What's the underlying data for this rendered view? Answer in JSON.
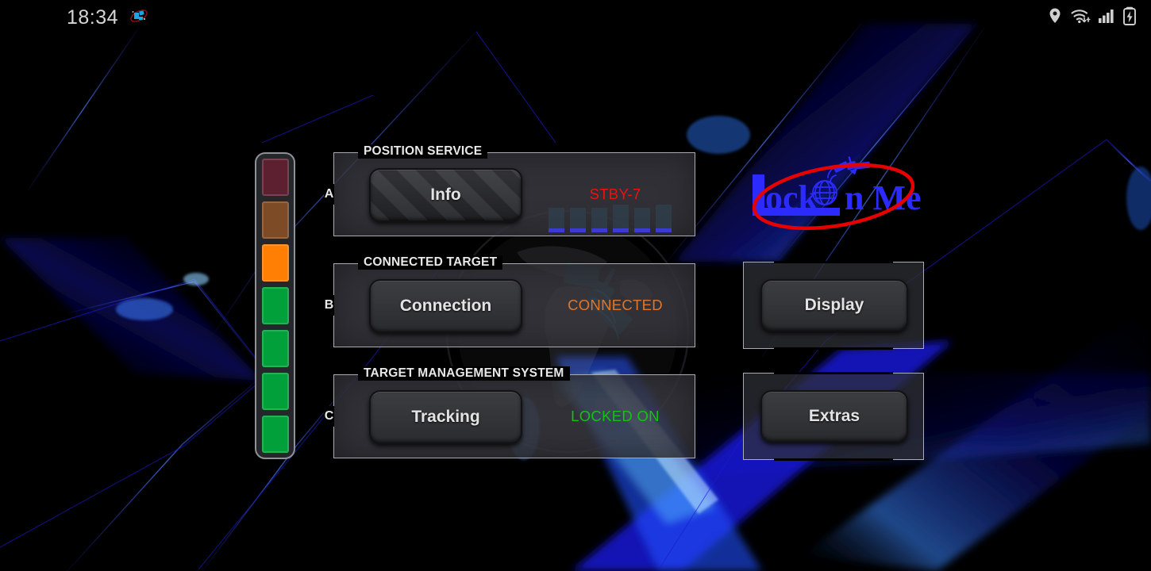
{
  "status_bar": {
    "time": "18:34",
    "notification_icons": [
      {
        "name": "satellite-app-icon"
      }
    ],
    "system_icons": [
      {
        "name": "location-pin-icon"
      },
      {
        "name": "wifi-icon"
      },
      {
        "name": "cellular-signal-icon"
      },
      {
        "name": "battery-charging-icon"
      }
    ]
  },
  "signal_meter": {
    "name": "signal-strength-meter",
    "segments": [
      {
        "index": 1,
        "color": "#5c2030"
      },
      {
        "index": 2,
        "color": "#7d4b26"
      },
      {
        "index": 3,
        "color": "#ff7f05"
      },
      {
        "index": 4,
        "color": "#02a03a"
      },
      {
        "index": 5,
        "color": "#02a03a"
      },
      {
        "index": 6,
        "color": "#02a03a"
      },
      {
        "index": 7,
        "color": "#02a03a"
      }
    ]
  },
  "panels": [
    {
      "key": "a",
      "side_label": "A",
      "legend": "POSITION SERVICE",
      "button_label": "Info",
      "button_disabled": true,
      "status_label": "STBY-7",
      "status_color": "#ee1111",
      "satellite_bars": [
        26,
        26,
        26,
        30,
        26,
        30
      ]
    },
    {
      "key": "b",
      "side_label": "B",
      "legend": "CONNECTED TARGET",
      "button_label": "Connection",
      "button_disabled": false,
      "status_label": "CONNECTED",
      "status_color": "#e0762a"
    },
    {
      "key": "c",
      "side_label": "C",
      "legend": "TARGET MANAGEMENT SYSTEM",
      "button_label": "Tracking",
      "button_disabled": false,
      "status_label": "LOCKED ON",
      "status_color": "#13c313"
    }
  ],
  "right_panels": [
    {
      "key": "display",
      "button_label": "Display"
    },
    {
      "key": "extras",
      "button_label": "Extras"
    }
  ],
  "logo": {
    "text_part1": "L",
    "text_part2": "ock ",
    "text_part3": "n Me",
    "text_color": "#2b2bff",
    "orbit_color": "#e60000",
    "globe_letter_name": "globe-o-icon",
    "satellite_name": "satellite-icon"
  },
  "colors": {
    "background": "#000000",
    "panel_fill": "#3a3b42",
    "panel_border": "#a9acb2",
    "button_face": "#343539",
    "accent_blue": "#1a1aff"
  }
}
